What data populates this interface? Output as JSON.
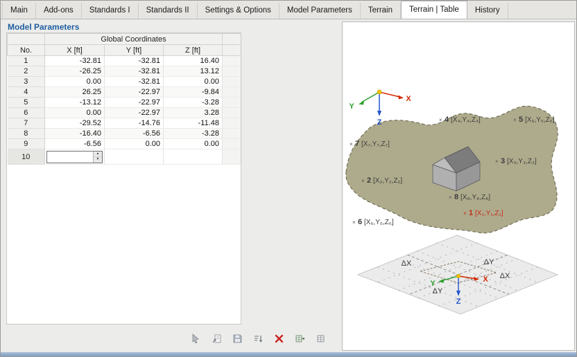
{
  "window": {
    "tabs": [
      {
        "label": "Main"
      },
      {
        "label": "Add-ons"
      },
      {
        "label": "Standards I"
      },
      {
        "label": "Standards II"
      },
      {
        "label": "Settings & Options"
      },
      {
        "label": "Model Parameters"
      },
      {
        "label": "Terrain"
      },
      {
        "label": "Terrain | Table"
      },
      {
        "label": "History"
      }
    ],
    "active_tab": "Terrain | Table"
  },
  "panel": {
    "title": "Model Parameters"
  },
  "table": {
    "group_header": "Global Coordinates",
    "headers": {
      "no": "No.",
      "x": "X [ft]",
      "y": "Y [ft]",
      "z": "Z [ft]"
    },
    "rows": [
      {
        "no": "1",
        "x": "-32.81",
        "y": "-32.81",
        "z": "16.40"
      },
      {
        "no": "2",
        "x": "-26.25",
        "y": "-32.81",
        "z": "13.12"
      },
      {
        "no": "3",
        "x": "0.00",
        "y": "-32.81",
        "z": "0.00"
      },
      {
        "no": "4",
        "x": "26.25",
        "y": "-22.97",
        "z": "-9.84"
      },
      {
        "no": "5",
        "x": "-13.12",
        "y": "-22.97",
        "z": "-3.28"
      },
      {
        "no": "6",
        "x": "0.00",
        "y": "-22.97",
        "z": "3.28"
      },
      {
        "no": "7",
        "x": "-29.52",
        "y": "-14.76",
        "z": "-11.48"
      },
      {
        "no": "8",
        "x": "-16.40",
        "y": "-6.56",
        "z": "-3.28"
      },
      {
        "no": "9",
        "x": "-6.56",
        "y": "0.00",
        "z": "0.00"
      }
    ],
    "edit_row": {
      "no": "10",
      "value": ""
    }
  },
  "toolbar": {
    "buttons": [
      {
        "name": "pick"
      },
      {
        "name": "import"
      },
      {
        "name": "save"
      },
      {
        "name": "sort"
      },
      {
        "name": "delete-all"
      },
      {
        "name": "export-table"
      },
      {
        "name": "table"
      }
    ]
  },
  "icons": {
    "spin_up": "▲",
    "spin_down": "▼"
  },
  "terrain": {
    "marker_glyph": "×",
    "points": [
      {
        "n": "1",
        "coords": "[X₁,Y₁,Z₁]"
      },
      {
        "n": "2",
        "coords": "[X₂,Y₂,Z₂]"
      },
      {
        "n": "3",
        "coords": "[X₃,Y₃,Z₃]"
      },
      {
        "n": "4",
        "coords": "[X₄,Y₄,Z₄]"
      },
      {
        "n": "5",
        "coords": "[X₅,Y₅,Z₅]"
      },
      {
        "n": "6",
        "coords": "[X₆,Y₆,Z₆]"
      },
      {
        "n": "7",
        "coords": "[X₇,Y₇,Z₇]"
      },
      {
        "n": "8",
        "coords": "[X₈,Y₈,Z₈]"
      }
    ],
    "axes": {
      "x": "X",
      "y": "Y",
      "z": "Z"
    },
    "deltas": {
      "dx": "ΔX",
      "dy": "ΔY"
    }
  },
  "colors": {
    "axis_x": "#d42a00",
    "axis_y": "#2ca02c",
    "axis_z": "#2255cc",
    "origin": "#f5c400",
    "terrain_fill": "#aeab8c",
    "point_highlight": "#c9291a",
    "title": "#1f5fa0",
    "delete_icon": "#cc2222"
  }
}
